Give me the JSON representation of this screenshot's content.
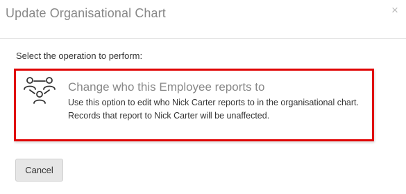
{
  "dialog": {
    "title": "Update Organisational Chart",
    "close_glyph": "×",
    "prompt": "Select the operation to perform:"
  },
  "option": {
    "icon": "org-chart-icon",
    "title": "Change who this Employee reports to",
    "description_line1": "Use this option to edit who Nick Carter reports to in the organisational chart.",
    "description_line2": "Records that report to Nick Carter will be unaffected.",
    "highlight_color": "#e00000"
  },
  "footer": {
    "cancel_label": "Cancel"
  }
}
